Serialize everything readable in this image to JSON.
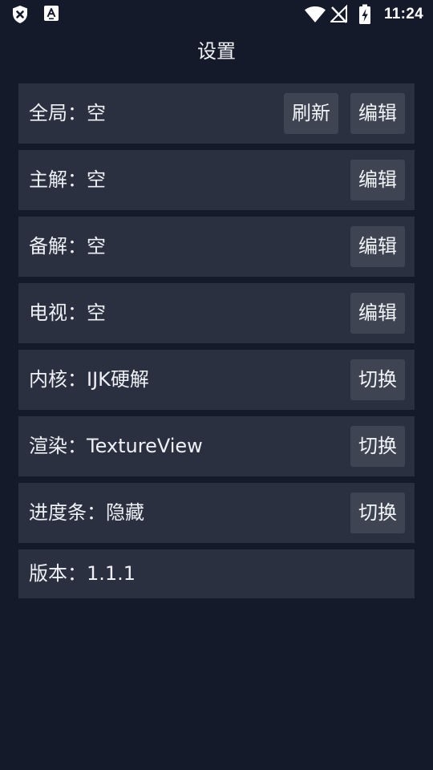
{
  "status_bar": {
    "time": "11:24",
    "left_icons": [
      "shield-x-icon",
      "a-square-icon"
    ],
    "right_icons": [
      "wifi-icon",
      "no-signal-icon",
      "battery-charging-icon"
    ]
  },
  "header": {
    "title": "设置"
  },
  "rows": [
    {
      "label": "全局：空",
      "buttons": [
        "刷新",
        "编辑"
      ]
    },
    {
      "label": "主解：空",
      "buttons": [
        "编辑"
      ]
    },
    {
      "label": "备解：空",
      "buttons": [
        "编辑"
      ]
    },
    {
      "label": "电视：空",
      "buttons": [
        "编辑"
      ]
    },
    {
      "label": "内核：IJK硬解",
      "buttons": [
        "切换"
      ]
    },
    {
      "label": "渲染：TextureView",
      "buttons": [
        "切换"
      ]
    },
    {
      "label": "进度条：隐藏",
      "buttons": [
        "切换"
      ]
    }
  ],
  "version": {
    "label": "版本：1.1.1"
  },
  "colors": {
    "background": "#141a29",
    "row": "#2b3040",
    "button": "#3f4453",
    "text": "#eef0f5"
  }
}
